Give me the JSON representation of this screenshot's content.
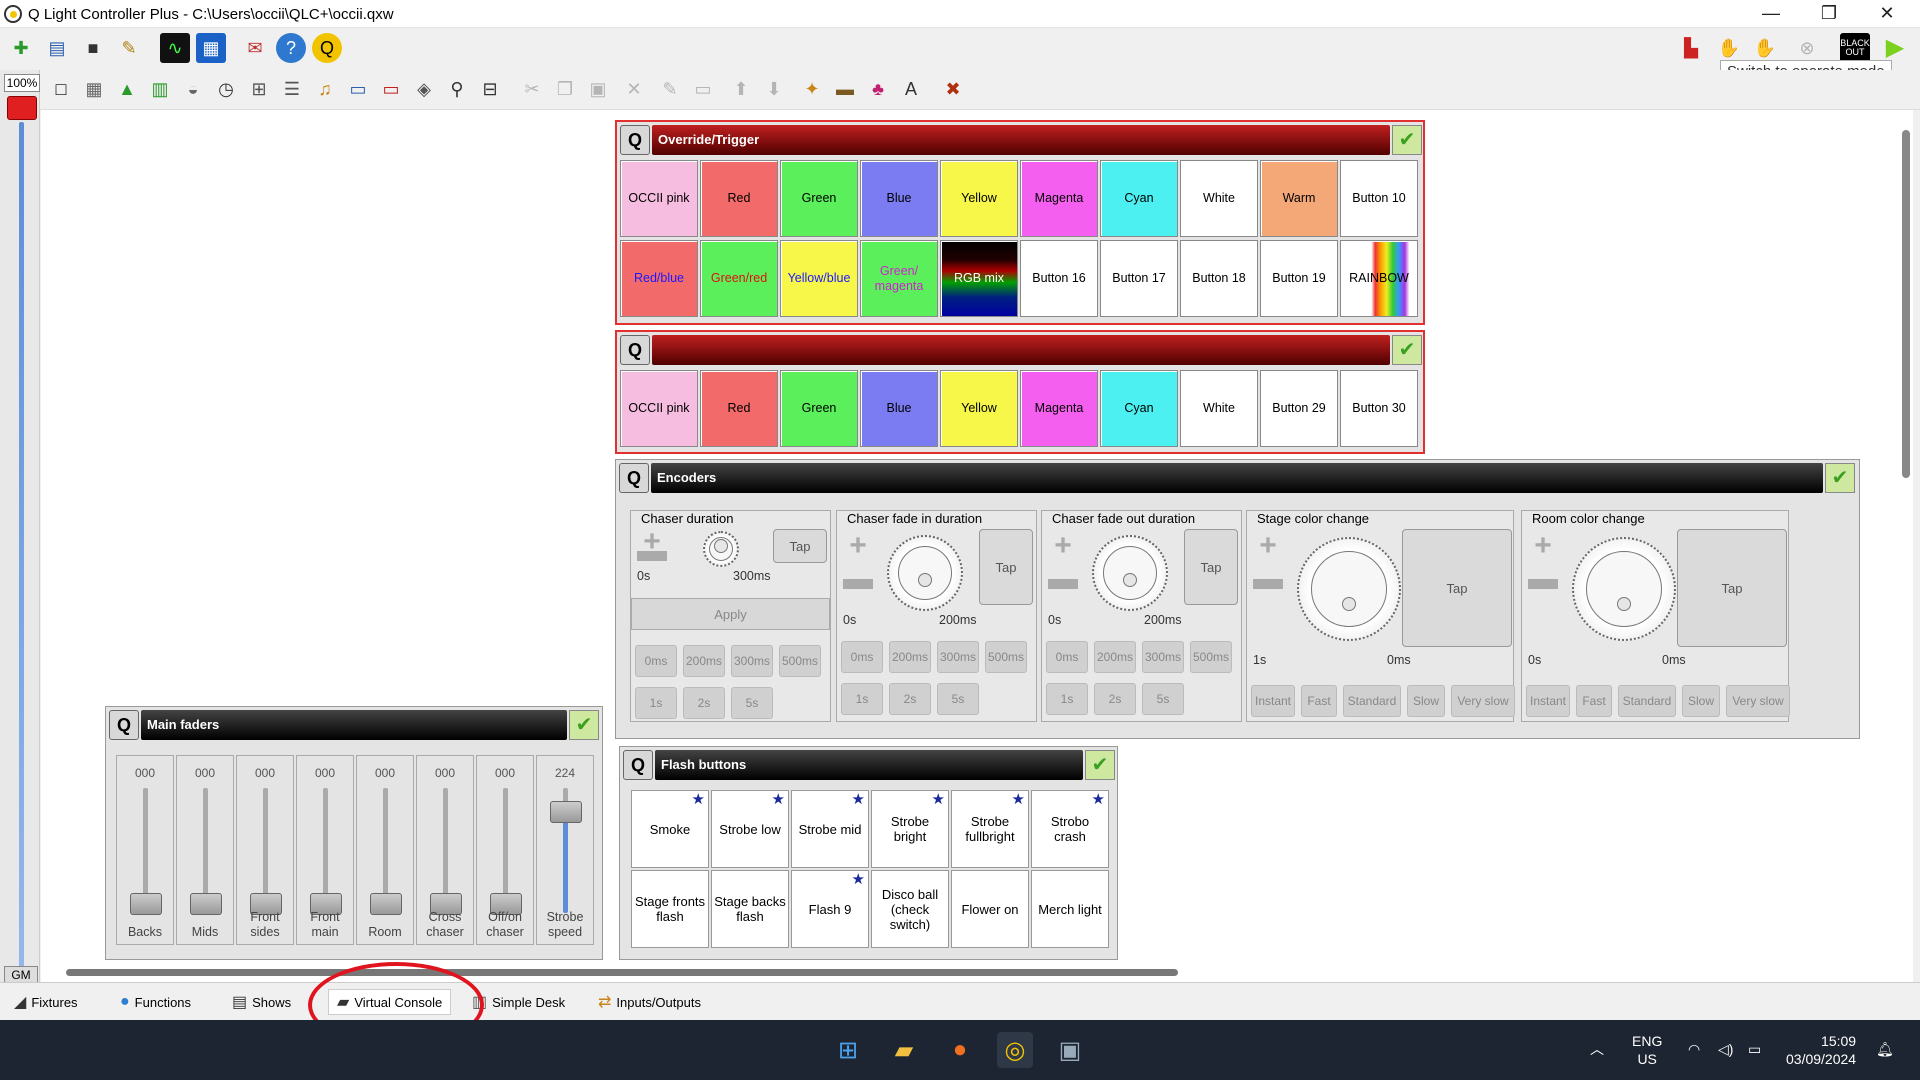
{
  "window": {
    "title": "Q Light Controller Plus - C:\\Users\\occii\\QLC+\\occii.qxw",
    "minimize": "—",
    "restore": "❐",
    "close": "✕"
  },
  "tooltip": "Switch to operate mode",
  "zoom": "100%",
  "gm_label": "GM",
  "toolbar1_icons": [
    "new-workspace-icon",
    "open-icon",
    "save-icon",
    "save-as-icon",
    "monitor-icon",
    "address-tool-icon",
    "fixture-editor-icon",
    "help-icon",
    "about-icon"
  ],
  "toolbar2_icons": [
    "add-button-icon",
    "add-matrix-icon",
    "add-slider-icon",
    "add-xypad-icon",
    "add-knob-icon",
    "add-speed-dial-icon",
    "add-frame-icon",
    "add-cue-list-icon",
    "add-audio-icon",
    "add-solo-frame-icon",
    "add-label-icon",
    "add-clock-icon",
    "add-animation-icon",
    "edit-icon"
  ],
  "frames": {
    "override": {
      "title": "Override/Trigger",
      "buttons": [
        {
          "label": "OCCII pink",
          "bg": "#f7bde0",
          "fg": "#000"
        },
        {
          "label": "Red",
          "bg": "#f26a6a",
          "fg": "#000"
        },
        {
          "label": "Green",
          "bg": "#5bf05b",
          "fg": "#000"
        },
        {
          "label": "Blue",
          "bg": "#7b7cf2",
          "fg": "#000"
        },
        {
          "label": "Yellow",
          "bg": "#f7f74a",
          "fg": "#000"
        },
        {
          "label": "Magenta",
          "bg": "#f55ff0",
          "fg": "#000"
        },
        {
          "label": "Cyan",
          "bg": "#4df0f0",
          "fg": "#000"
        },
        {
          "label": "White",
          "bg": "#ffffff",
          "fg": "#000"
        },
        {
          "label": "Warm",
          "bg": "#f4a878",
          "fg": "#000"
        },
        {
          "label": "Button 10",
          "bg": "#ffffff",
          "fg": "#000"
        },
        {
          "label": "Red/blue",
          "bg": "#f26a6a",
          "fg": "#1a1aff"
        },
        {
          "label": "Green/red",
          "bg": "#5bf05b",
          "fg": "#e01010"
        },
        {
          "label": "Yellow/blue",
          "bg": "#f7f74a",
          "fg": "#1a1aff"
        },
        {
          "label": "Green/ magenta",
          "bg": "#5bf05b",
          "fg": "#d020d0"
        },
        {
          "label": "RGB mix",
          "bg": "rgb",
          "fg": "#fff"
        },
        {
          "label": "Button 16",
          "bg": "#ffffff",
          "fg": "#000"
        },
        {
          "label": "Button 17",
          "bg": "#ffffff",
          "fg": "#000"
        },
        {
          "label": "Button 18",
          "bg": "#ffffff",
          "fg": "#000"
        },
        {
          "label": "Button 19",
          "bg": "#ffffff",
          "fg": "#000"
        },
        {
          "label": "RAINBOW",
          "bg": "rainbow",
          "fg": "#000"
        }
      ]
    },
    "second": {
      "title": "",
      "buttons": [
        {
          "label": "OCCII pink",
          "bg": "#f7bde0",
          "fg": "#000"
        },
        {
          "label": "Red",
          "bg": "#f26a6a",
          "fg": "#000"
        },
        {
          "label": "Green",
          "bg": "#5bf05b",
          "fg": "#000"
        },
        {
          "label": "Blue",
          "bg": "#7b7cf2",
          "fg": "#000"
        },
        {
          "label": "Yellow",
          "bg": "#f7f74a",
          "fg": "#000"
        },
        {
          "label": "Magenta",
          "bg": "#f55ff0",
          "fg": "#000"
        },
        {
          "label": "Cyan",
          "bg": "#4df0f0",
          "fg": "#000"
        },
        {
          "label": "White",
          "bg": "#ffffff",
          "fg": "#000"
        },
        {
          "label": "Button 29",
          "bg": "#ffffff",
          "fg": "#000"
        },
        {
          "label": "Button 30",
          "bg": "#ffffff",
          "fg": "#000"
        }
      ]
    },
    "encoders": {
      "title": "Encoders"
    },
    "main_faders": {
      "title": "Main faders"
    },
    "flash": {
      "title": "Flash buttons"
    }
  },
  "encoders": [
    {
      "title": "Chaser duration",
      "min": "0s",
      "value": "300ms",
      "tap": "Tap",
      "apply": "Apply",
      "presets": [
        "0ms",
        "200ms",
        "300ms",
        "500ms",
        "1s",
        "2s",
        "5s"
      ]
    },
    {
      "title": "Chaser fade in duration",
      "min": "0s",
      "value": "200ms",
      "tap": "Tap",
      "presets": [
        "0ms",
        "200ms",
        "300ms",
        "500ms",
        "1s",
        "2s",
        "5s"
      ]
    },
    {
      "title": "Chaser fade out duration",
      "min": "0s",
      "value": "200ms",
      "tap": "Tap",
      "presets": [
        "0ms",
        "200ms",
        "300ms",
        "500ms",
        "1s",
        "2s",
        "5s"
      ]
    },
    {
      "title": "Stage color change",
      "min": "1s",
      "value": "0ms",
      "tap": "Tap",
      "presets": [
        "Instant",
        "Fast",
        "Standard",
        "Slow",
        "Very slow"
      ]
    },
    {
      "title": "Room color change",
      "min": "0s",
      "value": "0ms",
      "tap": "Tap",
      "presets": [
        "Instant",
        "Fast",
        "Standard",
        "Slow",
        "Very slow"
      ]
    }
  ],
  "faders": [
    {
      "value": "000",
      "name": "Backs",
      "level": 0.0
    },
    {
      "value": "000",
      "name": "Mids",
      "level": 0.0
    },
    {
      "value": "000",
      "name": "Front sides",
      "level": 0.0
    },
    {
      "value": "000",
      "name": "Front main",
      "level": 0.0
    },
    {
      "value": "000",
      "name": "Room",
      "level": 0.0
    },
    {
      "value": "000",
      "name": "Cross chaser",
      "level": 0.0
    },
    {
      "value": "000",
      "name": "Off/on chaser",
      "level": 0.0
    },
    {
      "value": "224",
      "name": "Strobe speed",
      "level": 0.878
    }
  ],
  "flash_buttons": [
    {
      "label": "Smoke",
      "star": true
    },
    {
      "label": "Strobe low",
      "star": true
    },
    {
      "label": "Strobe mid",
      "star": true
    },
    {
      "label": "Strobe bright",
      "star": true
    },
    {
      "label": "Strobe fullbright",
      "star": true
    },
    {
      "label": "Strobo crash",
      "star": true
    },
    {
      "label": "Stage fronts flash",
      "star": false
    },
    {
      "label": "Stage backs flash",
      "star": false
    },
    {
      "label": "Flash 9",
      "star": true
    },
    {
      "label": "Disco ball (check switch)",
      "star": false
    },
    {
      "label": "Flower on",
      "star": false
    },
    {
      "label": "Merch light",
      "star": false
    }
  ],
  "tabs": [
    {
      "label": "Fixtures",
      "icon": "fixtures-icon"
    },
    {
      "label": "Functions",
      "icon": "functions-icon"
    },
    {
      "label": "Shows",
      "icon": "shows-icon"
    },
    {
      "label": "Virtual Console",
      "icon": "virtual-console-icon"
    },
    {
      "label": "Simple Desk",
      "icon": "simple-desk-icon"
    },
    {
      "label": "Inputs/Outputs",
      "icon": "inputs-outputs-icon"
    }
  ],
  "taskbar": {
    "lang1": "ENG",
    "lang2": "US",
    "time": "15:09",
    "date": "03/09/2024"
  },
  "blackout_label": "BLACK OUT"
}
